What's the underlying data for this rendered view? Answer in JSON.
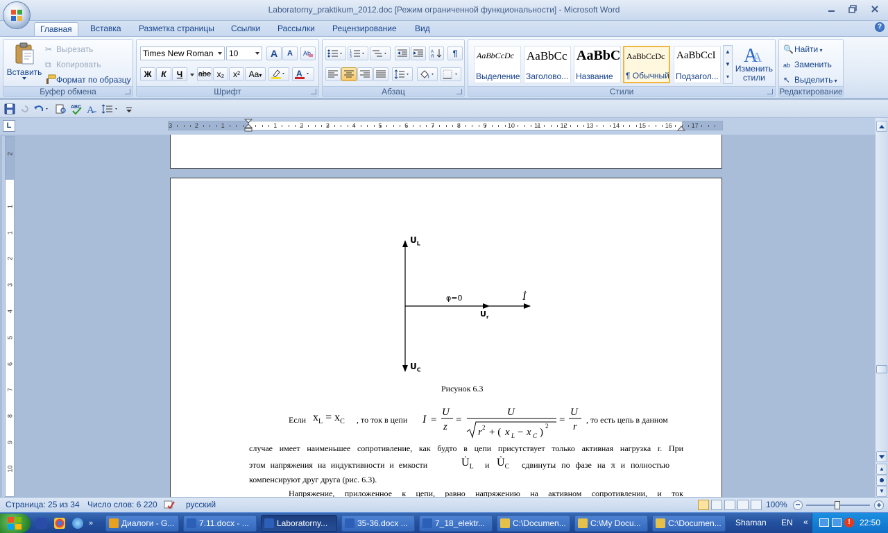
{
  "window": {
    "title": "Laboratorny_praktikum_2012.doc [Режим ограниченной функциональности] - Microsoft Word"
  },
  "tabs": [
    {
      "label": "Главная",
      "active": true
    },
    {
      "label": "Вставка"
    },
    {
      "label": "Разметка страницы"
    },
    {
      "label": "Ссылки"
    },
    {
      "label": "Рассылки"
    },
    {
      "label": "Рецензирование"
    },
    {
      "label": "Вид"
    }
  ],
  "ribbon": {
    "clipboard": {
      "label": "Буфер обмена",
      "paste": "Вставить",
      "cut": "Вырезать",
      "copy": "Копировать",
      "format_painter": "Формат по образцу"
    },
    "font": {
      "label": "Шрифт",
      "font_name": "Times New Roman",
      "font_size": "10",
      "bold": "Ж",
      "italic": "К",
      "underline": "Ч",
      "strike": "abe",
      "subscript": "x₂",
      "superscript": "x²",
      "change_case": "Aa",
      "grow": "A",
      "shrink": "A",
      "font_color": "#d02020",
      "highlight_color": "#f5e12a"
    },
    "paragraph": {
      "label": "Абзац"
    },
    "styles": {
      "label": "Стили",
      "items": [
        {
          "preview": "AaBbCcDc",
          "name": "Выделение"
        },
        {
          "preview": "AaBbCc",
          "name": "Заголово..."
        },
        {
          "preview": "AaBbC",
          "name": "Название"
        },
        {
          "preview": "AaBbCcDc",
          "name": "¶ Обычный",
          "selected": true
        },
        {
          "preview": "AaBbCcI",
          "name": "Подзагол..."
        }
      ],
      "change_styles": "Изменить стили"
    },
    "editing": {
      "label": "Редактирование",
      "find": "Найти",
      "replace": "Заменить",
      "select": "Выделить"
    }
  },
  "ruler": {
    "toggle": "L",
    "numbers": [
      "3",
      "2",
      "1",
      "1",
      "2",
      "3",
      "4",
      "5",
      "6",
      "7",
      "8",
      "9",
      "10",
      "11",
      "12",
      "13",
      "14",
      "15",
      "16",
      "17"
    ],
    "vertical_numbers": [
      "2",
      "1",
      "1",
      "2",
      "3",
      "4",
      "5",
      "6",
      "7",
      "8",
      "9",
      "10"
    ]
  },
  "document": {
    "figure": {
      "axis_top": "U",
      "axis_top_sub": "L",
      "axis_bottom": "U",
      "axis_bottom_sub": "C",
      "phase": "φ=0",
      "current": "İ",
      "resistor": "U",
      "resistor_sub": "r",
      "caption": "Рисунок 6.3"
    },
    "para1_start": "Если",
    "para1_mid": ", то ток в цепи",
    "para1_end": ", то есть цепь в данном",
    "line2": "случае имеет наименьшее сопротивление, как будто в цепи присутствует только активная нагрузка r. При",
    "line3_a": "этом напряжения на индуктивности и емкости",
    "line3_b": "и",
    "line3_c": "сдвинуты по фазе на π и полностью",
    "line4": "компенсируют друг друга (рис. 6.3).",
    "line5": "Напряжение, приложенное к цепи, равно напряжению на активном сопротивлении, и ток"
  },
  "statusbar": {
    "page": "Страница: 25 из 34",
    "words": "Число слов: 6 220",
    "language": "русский",
    "zoom": "100%"
  },
  "taskbar": {
    "items": [
      {
        "label": "Диалоги - G...",
        "color": "#e8a020"
      },
      {
        "label": "7.11.docx - ...",
        "color": "#2b5fb8"
      },
      {
        "label": "Laboratorny...",
        "color": "#2b5fb8",
        "active": true
      },
      {
        "label": "35-36.docx ...",
        "color": "#2b5fb8"
      },
      {
        "label": "7_18_elektr...",
        "color": "#2b5fb8"
      },
      {
        "label": "C:\\Documen...",
        "color": "#e6c14a"
      },
      {
        "label": "C:\\My Docu...",
        "color": "#e6c14a"
      },
      {
        "label": "C:\\Documen...",
        "color": "#e6c14a"
      }
    ],
    "user": "Shaman",
    "lang": "EN",
    "time": "22:50"
  }
}
